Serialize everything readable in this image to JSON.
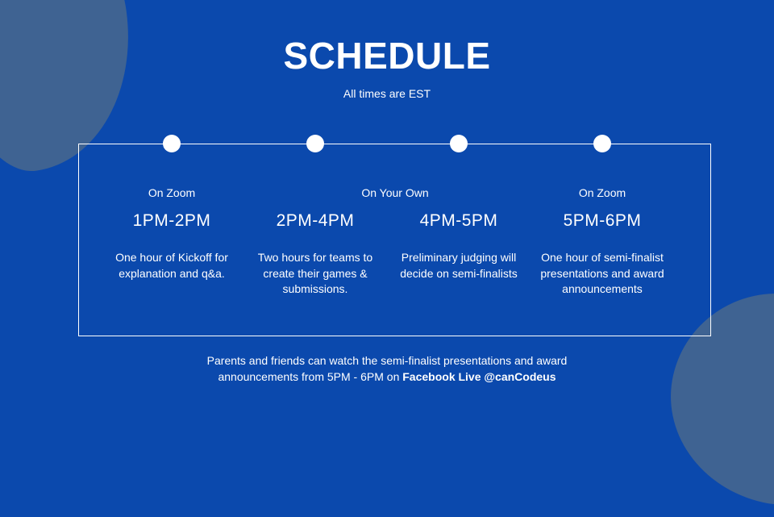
{
  "title": "SCHEDULE",
  "subtitle": "All times are EST",
  "columns": [
    {
      "location": "On Zoom",
      "time": "1PM-2PM",
      "desc": "One hour of Kickoff for explanation and q&a."
    },
    {
      "time": "2PM-4PM",
      "desc": "Two hours for teams to create their games & submissions."
    },
    {
      "time": "4PM-5PM",
      "desc": "Preliminary judging will decide on semi-finalists"
    },
    {
      "location": "On Zoom",
      "time": "5PM-6PM",
      "desc": "One hour of semi-finalist presentations and award announcements"
    }
  ],
  "shared_location": "On Your Own",
  "footer": {
    "line1": "Parents and friends can watch the semi-finalist presentations and award",
    "line2_prefix": "announcements from 5PM - 6PM on ",
    "line2_bold": "Facebook Live @canCodeus"
  },
  "colors": {
    "background": "#0b49ad",
    "blob": "#3f6392",
    "text": "#ffffff"
  }
}
